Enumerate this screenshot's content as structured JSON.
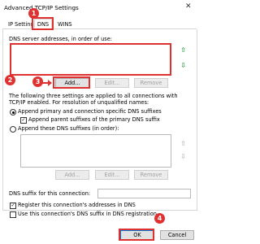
{
  "window": {
    "title": "Advanced TCP/IP Settings",
    "close_glyph": "✕"
  },
  "tabs": [
    {
      "label": "IP Settings"
    },
    {
      "label": "DNS"
    },
    {
      "label": "WINS"
    }
  ],
  "dns_servers": {
    "label": "DNS server addresses, in order of use:",
    "buttons": {
      "add": "Add...",
      "edit": "Edit...",
      "remove": "Remove"
    }
  },
  "resolution": {
    "description": "The following three settings are applied to all connections with TCP/IP enabled. For resolution of unqualified names:",
    "option_primary": "Append primary and connection specific DNS suffixes",
    "option_parent": "Append parent suffixes of the primary DNS suffix",
    "option_these": "Append these DNS suffixes (in order):",
    "buttons": {
      "add": "Add...",
      "edit": "Edit...",
      "remove": "Remove"
    }
  },
  "suffix": {
    "label": "DNS suffix for this connection:",
    "value": ""
  },
  "register": {
    "register_addresses": "Register this connection's addresses in DNS",
    "use_suffix": "Use this connection's DNS suffix in DNS registration"
  },
  "footer": {
    "ok": "OK",
    "cancel": "Cancel"
  },
  "annotations": {
    "step1": "1",
    "step2": "2",
    "step3": "3",
    "step4": "4"
  }
}
